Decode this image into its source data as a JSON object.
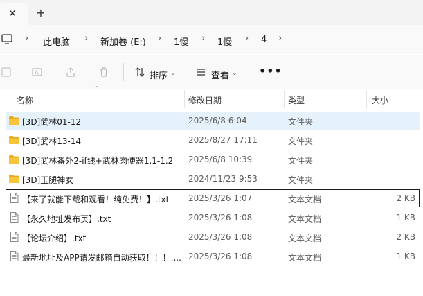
{
  "tabs": {
    "close_label": "✕",
    "new_tab_label": "+"
  },
  "breadcrumb": [
    "此电脑",
    "新加卷 (E:)",
    "1慢",
    "1慢",
    "4"
  ],
  "toolbar": {
    "sort_label": "排序",
    "view_label": "查看",
    "more_label": "•••"
  },
  "columns": {
    "name": "名称",
    "date": "修改日期",
    "type": "类型",
    "size": "大小"
  },
  "files": [
    {
      "name": "[3D]武林01-12",
      "date": "2025/6/8 6:04",
      "type": "文件夹",
      "size": "",
      "kind": "folder",
      "selected": true
    },
    {
      "name": "[3D]武林13-14",
      "date": "2025/8/27 17:11",
      "type": "文件夹",
      "size": "",
      "kind": "folder"
    },
    {
      "name": "[3D]武林番外2-if线+武林肉便器1.1-1.2",
      "date": "2025/6/8 10:39",
      "type": "文件夹",
      "size": "",
      "kind": "folder"
    },
    {
      "name": "[3D]玉腿神女",
      "date": "2024/11/23 9:53",
      "type": "文件夹",
      "size": "",
      "kind": "folder"
    },
    {
      "name": "【来了就能下载和观看！纯免费！】.txt",
      "date": "2025/3/26 1:07",
      "type": "文本文档",
      "size": "2 KB",
      "kind": "txt",
      "focused": true
    },
    {
      "name": "【永久地址发布页】.txt",
      "date": "2025/3/26 1:08",
      "type": "文本文档",
      "size": "1 KB",
      "kind": "txt"
    },
    {
      "name": "【论坛介绍】.txt",
      "date": "2025/3/26 1:08",
      "type": "文本文档",
      "size": "2 KB",
      "kind": "txt"
    },
    {
      "name": "最新地址及APP请发邮箱自动获取！！！....",
      "date": "2025/3/26 1:08",
      "type": "文本文档",
      "size": "1 KB",
      "kind": "txt"
    }
  ],
  "colors": {
    "folder": "#f8c53a",
    "folder_dark": "#e8a91c",
    "selection": "#e5f1fb"
  }
}
